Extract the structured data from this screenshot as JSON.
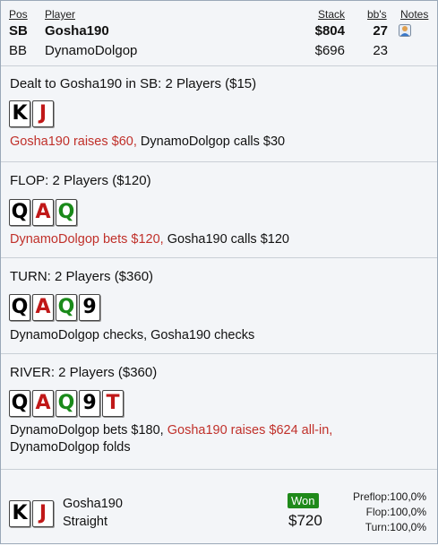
{
  "header": {
    "col_pos": "Pos",
    "col_player": "Player",
    "col_stack": "Stack",
    "col_bbs": "bb's",
    "col_notes": "Notes"
  },
  "players": [
    {
      "pos": "SB",
      "name": "Gosha190",
      "stack": "$804",
      "bbs": "27",
      "bold": true,
      "has_note": true
    },
    {
      "pos": "BB",
      "name": "DynamoDolgop",
      "stack": "$696",
      "bbs": "23",
      "bold": false,
      "has_note": false
    }
  ],
  "preflop": {
    "title": "Dealt to Gosha190 in SB: 2 Players ($15)",
    "cards": [
      {
        "rank": "K",
        "color": "black"
      },
      {
        "rank": "J",
        "color": "red"
      }
    ],
    "action_red": "Gosha190 raises $60,",
    "action_black": " DynamoDolgop calls $30"
  },
  "flop": {
    "title": "FLOP: 2 Players ($120)",
    "cards": [
      {
        "rank": "Q",
        "color": "black"
      },
      {
        "rank": "A",
        "color": "red"
      },
      {
        "rank": "Q",
        "color": "green"
      }
    ],
    "action_red": "DynamoDolgop bets $120,",
    "action_black": " Gosha190 calls $120"
  },
  "turn": {
    "title": "TURN: 2 Players ($360)",
    "cards": [
      {
        "rank": "Q",
        "color": "black"
      },
      {
        "rank": "A",
        "color": "red"
      },
      {
        "rank": "Q",
        "color": "green"
      },
      {
        "rank": "9",
        "color": "black"
      }
    ],
    "action_black": "DynamoDolgop checks, Gosha190 checks"
  },
  "river": {
    "title": "RIVER: 2 Players ($360)",
    "cards": [
      {
        "rank": "Q",
        "color": "black"
      },
      {
        "rank": "A",
        "color": "red"
      },
      {
        "rank": "Q",
        "color": "green"
      },
      {
        "rank": "9",
        "color": "black"
      },
      {
        "rank": "T",
        "color": "red"
      }
    ],
    "action_line1_black": "DynamoDolgop bets $180, ",
    "action_line1_red": "Gosha190 raises $624 all-in,",
    "action_line2": "DynamoDolgop folds"
  },
  "summary": {
    "cards": [
      {
        "rank": "K",
        "color": "black"
      },
      {
        "rank": "J",
        "color": "red"
      }
    ],
    "player": "Gosha190",
    "hand": "Straight",
    "won_label": "Won",
    "won_amount": "$720",
    "preflop_label": "Preflop:",
    "preflop_value": "100,0%",
    "flop_label": "Flop:",
    "flop_value": "100,0%",
    "turn_label": "Turn:",
    "turn_value": "100,0%"
  },
  "colors": {
    "red_action": "#c0302a",
    "won_badge": "#1f8a1a",
    "green_card": "#1a8a1a"
  }
}
